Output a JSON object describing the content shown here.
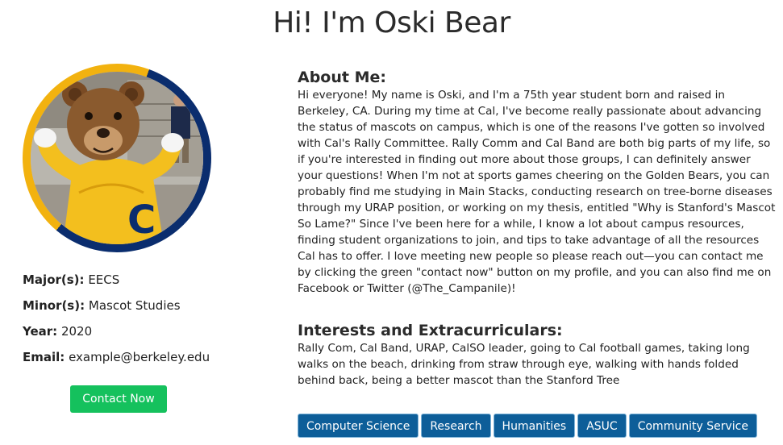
{
  "page": {
    "title": "Hi! I'm Oski Bear"
  },
  "profile": {
    "photo_icon": "mascot-photo",
    "ring_colors": [
      "#f2b20f",
      "#0a2d6e"
    ],
    "major_label": "Major(s):",
    "major_value": "EECS",
    "minor_label": "Minor(s):",
    "minor_value": "Mascot Studies",
    "year_label": "Year:",
    "year_value": "2020",
    "email_label": "Email:",
    "email_value": "example@berkeley.edu",
    "contact_label": "Contact Now",
    "contact_color": "#15c15d"
  },
  "about": {
    "heading": "About Me:",
    "text": "Hi everyone! My name is Oski, and I'm a 75th year student born and raised in Berkeley, CA. During my time at Cal, I've become really passionate about advancing the status of mascots on campus, which is one of the reasons I've gotten so involved with Cal's Rally Committee. Rally Comm and Cal Band are both big parts of my life, so if you're interested in finding out more about those groups, I can definitely answer your questions! When I'm not at sports games cheering on the Golden Bears, you can probably find me studying in Main Stacks, conducting research on tree-borne diseases through my URAP position, or working on my thesis, entitled \"Why is Stanford's Mascot So Lame?\" Since I've been here for a while, I know a lot about campus resources, finding student organizations to join, and tips to take advantage of all the resources Cal has to offer. I love meeting new people so please reach out—you can contact me by clicking the green \"contact now\" button on my profile, and you can also find me on Facebook or Twitter (@The_Campanile)!"
  },
  "interests": {
    "heading": "Interests and Extracurriculars:",
    "text": "Rally Com, Cal Band, URAP, CalSO leader, going to Cal football games, taking long walks on the beach, drinking from straw through eye, walking with hands folded behind back, being a better mascot than the Stanford Tree"
  },
  "tags": {
    "color": "#0d5e99",
    "items": [
      "Computer Science",
      "Research",
      "Humanities",
      "ASUC",
      "Community Service"
    ]
  }
}
